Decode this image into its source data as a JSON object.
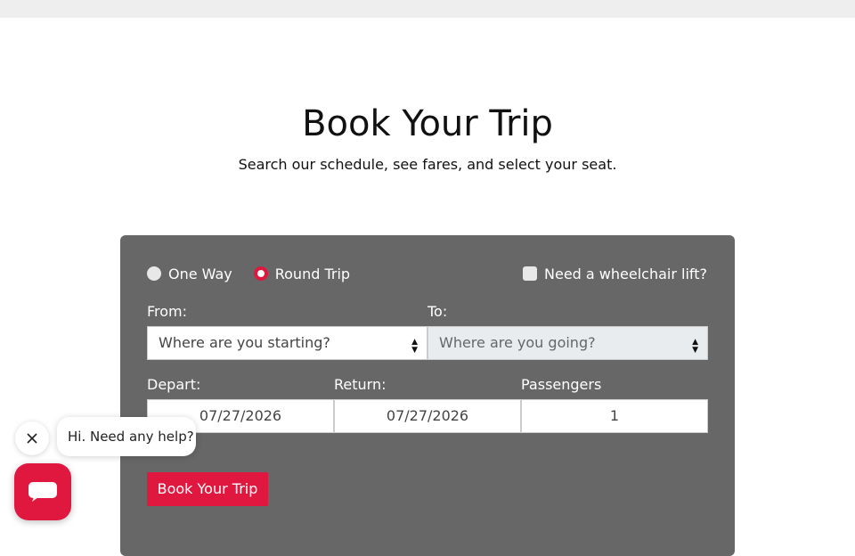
{
  "page": {
    "title": "Book Your Trip",
    "subtitle": "Search our schedule, see fares, and select your seat."
  },
  "form": {
    "trip_types": [
      {
        "label": "One Way",
        "selected": false
      },
      {
        "label": "Round Trip",
        "selected": true
      }
    ],
    "wheelchair": {
      "label": "Need a wheelchair lift?",
      "checked": false
    },
    "from": {
      "label": "From:",
      "value": "Where are you starting?"
    },
    "to": {
      "label": "To:",
      "value": "Where are you going?"
    },
    "depart": {
      "label": "Depart:",
      "value": "07/27/2026"
    },
    "return": {
      "label": "Return:",
      "value": "07/27/2026"
    },
    "passengers": {
      "label": "Passengers",
      "value": "1"
    },
    "submit_label": "Book Your Trip"
  },
  "chat": {
    "greeting": "Hi. Need any help?",
    "close_icon": "close-icon",
    "launcher_icon": "chat-icon"
  },
  "colors": {
    "accent": "#e0183f",
    "card": "#676767",
    "topbar": "#eeeeee"
  }
}
